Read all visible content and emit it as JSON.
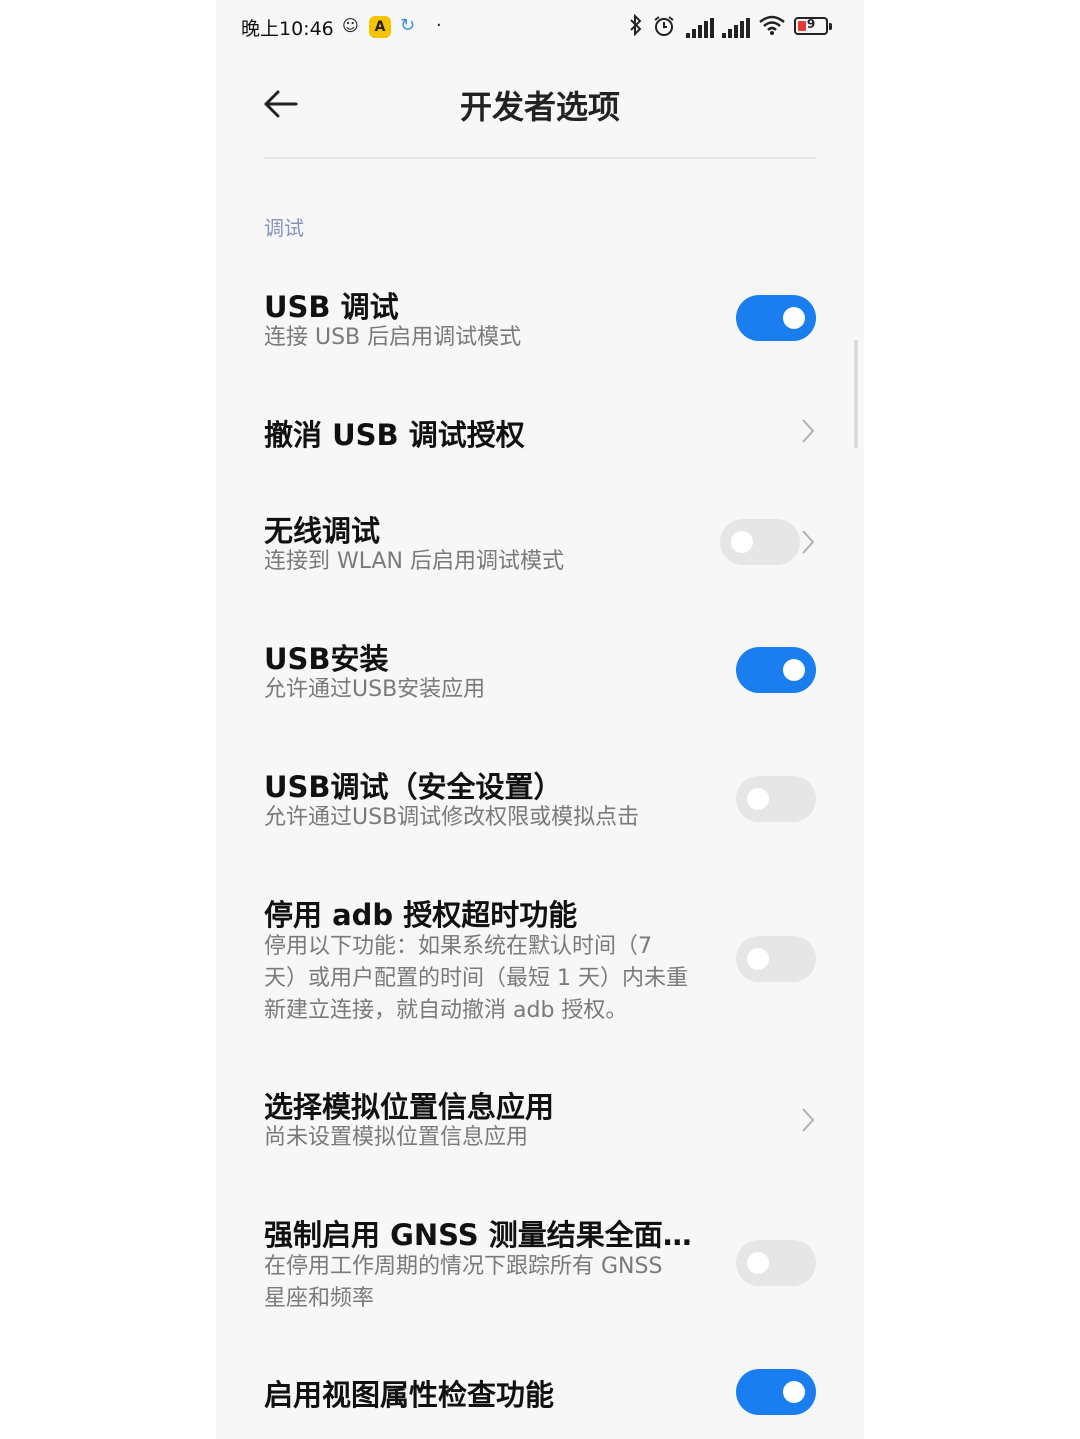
{
  "status_bar": {
    "time": "晚上10:46",
    "battery_level": "9",
    "icons": [
      "weibo-icon",
      "app-a-icon",
      "sync-icon",
      "dot-icon",
      "bluetooth-icon",
      "alarm-icon",
      "signal-icon",
      "hd-signal-icon",
      "wifi-icon",
      "battery-icon"
    ]
  },
  "header": {
    "title": "开发者选项",
    "back_icon": "back-arrow-icon"
  },
  "section": {
    "label": "调试"
  },
  "rows": [
    {
      "title": "USB 调试",
      "subtitle": "连接 USB 后启用调试模式",
      "control": "toggle",
      "state": "on"
    },
    {
      "title": "撤消 USB 调试授权",
      "control": "chevron"
    },
    {
      "title": "无线调试",
      "subtitle": "连接到 WLAN 后启用调试模式",
      "control": "toggle+chevron",
      "state": "off"
    },
    {
      "title": "USB安装",
      "subtitle": "允许通过USB安装应用",
      "control": "toggle",
      "state": "on"
    },
    {
      "title": "USB调试（安全设置）",
      "subtitle": "允许通过USB调试修改权限或模拟点击",
      "control": "toggle",
      "state": "off"
    },
    {
      "title": "停用 adb 授权超时功能",
      "subtitle_lines": [
        "停用以下功能：如果系统在默认时间（7",
        "天）或用户配置的时间（最短 1 天）内未重",
        "新建立连接，就自动撤消 adb 授权。"
      ],
      "control": "toggle",
      "state": "off"
    },
    {
      "title": "选择模拟位置信息应用",
      "subtitle": "尚未设置模拟位置信息应用",
      "control": "chevron"
    },
    {
      "title": "强制启用 GNSS 测量结果全面…",
      "subtitle_lines": [
        "在停用工作周期的情况下跟踪所有 GNSS",
        "星座和频率"
      ],
      "control": "toggle",
      "state": "off"
    },
    {
      "title": "启用视图属性检查功能",
      "control": "toggle",
      "state": "on"
    }
  ],
  "colors": {
    "toggle_on": "#1a7ef0",
    "toggle_off": "#e6e6e6",
    "section_label": "#8a93b8",
    "background": "#f7f7f7"
  }
}
